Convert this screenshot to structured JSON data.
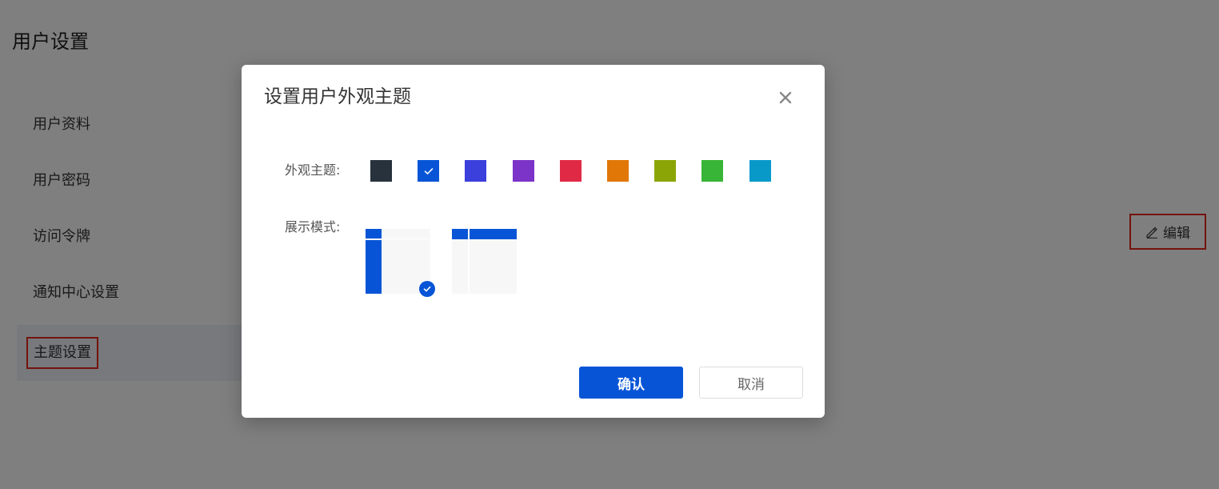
{
  "page": {
    "title": "用户设置"
  },
  "menu": {
    "items": [
      {
        "label": "用户资料"
      },
      {
        "label": "用户密码"
      },
      {
        "label": "访问令牌"
      },
      {
        "label": "通知中心设置"
      },
      {
        "label": "主题设置",
        "active": true
      }
    ]
  },
  "panel": {
    "edit_label": "编辑",
    "edit_icon": "pencil-icon"
  },
  "dialog": {
    "title": "设置用户外观主题",
    "close_icon": "close-icon",
    "theme_label": "外观主题:",
    "layout_label": "展示模式:",
    "themes": [
      {
        "color": "#27323d",
        "selected": false
      },
      {
        "color": "#0755d6",
        "selected": true
      },
      {
        "color": "#3b3fdb",
        "selected": false
      },
      {
        "color": "#7c33c7",
        "selected": false
      },
      {
        "color": "#e02a45",
        "selected": false
      },
      {
        "color": "#e07707",
        "selected": false
      },
      {
        "color": "#8ca506",
        "selected": false
      },
      {
        "color": "#38b536",
        "selected": false
      },
      {
        "color": "#0899c9",
        "selected": false
      }
    ],
    "layouts": [
      {
        "type": "sidebar",
        "selected": true
      },
      {
        "type": "topbar",
        "selected": false
      }
    ],
    "confirm_label": "确认",
    "cancel_label": "取消"
  },
  "colors": {
    "primary": "#0755d6",
    "highlight_border": "#e8261c",
    "overlay": "rgba(0,0,0,0.5)"
  }
}
